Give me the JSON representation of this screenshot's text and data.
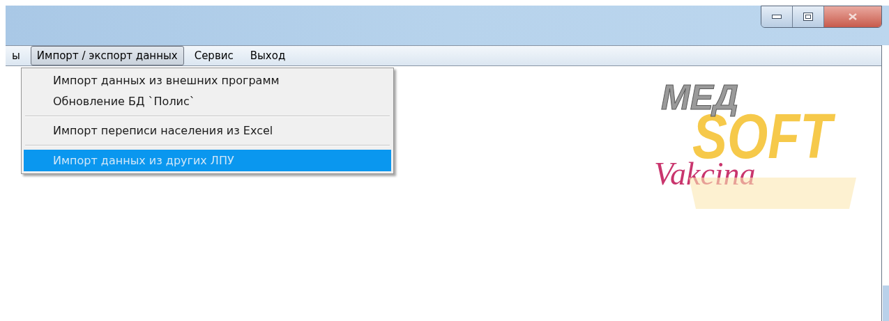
{
  "window_controls": [
    {
      "kind": "minimize"
    },
    {
      "kind": "maximize"
    },
    {
      "kind": "close"
    }
  ],
  "menu_bar": [
    {
      "label": "ы",
      "selected": false
    },
    {
      "label": "Импорт / экспорт данных",
      "selected": true
    },
    {
      "label": "Сервис",
      "selected": false
    },
    {
      "label": "Выход",
      "selected": false
    }
  ],
  "dropdown": [
    {
      "kind": "item",
      "label": "Импорт данных из внешних программ",
      "selected": false
    },
    {
      "kind": "item",
      "label": "Обновление БД `Полис`",
      "selected": false
    },
    {
      "kind": "separator"
    },
    {
      "kind": "item",
      "label": "Импорт переписи населения из Excel",
      "selected": false
    },
    {
      "kind": "separator"
    },
    {
      "kind": "item",
      "label": "Импорт данных из других ЛПУ",
      "selected": true
    }
  ],
  "logo": {
    "top": "МЕД",
    "main": "SOFT",
    "script": "Vakcina"
  }
}
